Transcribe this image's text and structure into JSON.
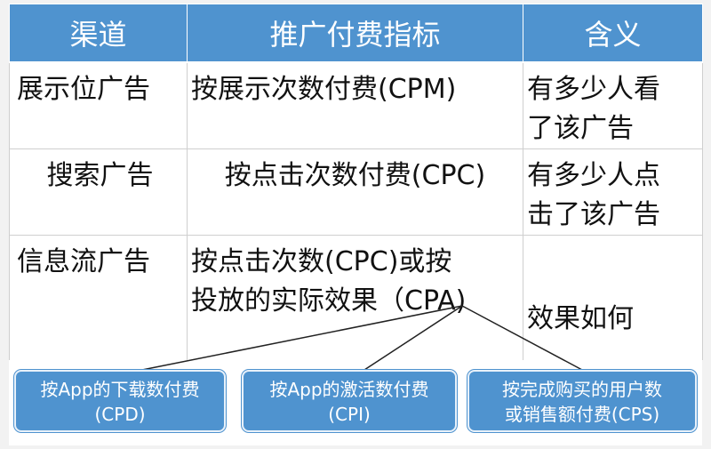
{
  "table": {
    "headers": [
      "渠道",
      "推广付费指标",
      "含义"
    ],
    "rows": [
      {
        "channel": "展示位广告",
        "metric": "按展示次数付费(CPM)",
        "meaning_line1": "有多少人看",
        "meaning_line2": "了该广告"
      },
      {
        "channel": "搜索广告",
        "metric": "按点击次数付费(CPC)",
        "meaning_line1": "有多少人点",
        "meaning_line2": "击了该广告"
      },
      {
        "channel": "信息流广告",
        "metric_line1": "按点击次数(CPC)或按",
        "metric_line2": "投放的实际效果（CPA)",
        "meaning": "效果如何"
      }
    ]
  },
  "callouts": [
    {
      "line1": "按App的下载数付费",
      "line2": "(CPD)"
    },
    {
      "line1": "按App的激活数付费",
      "line2": "(CPI)"
    },
    {
      "line1": "按完成购买的用户数",
      "line2": "或销售额付费(CPS)"
    }
  ],
  "colors": {
    "header_bg": "#4f93cf",
    "callout_bg": "#4f93cf",
    "text": "#111111"
  }
}
